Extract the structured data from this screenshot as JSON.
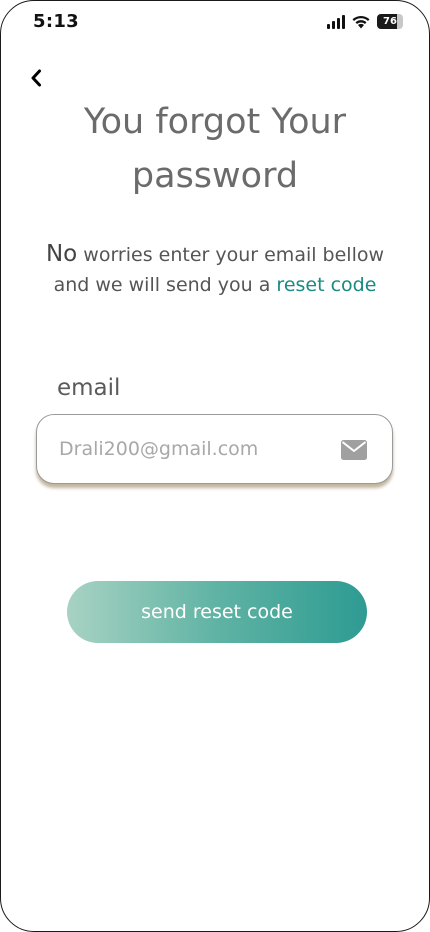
{
  "status_bar": {
    "time": "5:13",
    "battery": "76",
    "battery_level_percent": 76
  },
  "header": {
    "title_line1": "You forgot Your",
    "title_line2": "password"
  },
  "subtitle": {
    "first_word": "No",
    "rest_line1": " worries enter your email bellow",
    "line2_prefix": "and we will send you a ",
    "link_text": "reset code"
  },
  "form": {
    "email_label": "email",
    "email_placeholder": "Drali200@gmail.com",
    "submit_label": "send reset code"
  },
  "icons": {
    "back": "chevron-left-icon",
    "mail": "envelope-icon",
    "signal": "cellular-signal-icon",
    "wifi": "wifi-icon",
    "battery": "battery-icon"
  },
  "colors": {
    "accent": "#1a8a82",
    "button_gradient_start": "#a8d2c3",
    "button_gradient_end": "#2e9b92",
    "title": "#6b6b6b"
  }
}
